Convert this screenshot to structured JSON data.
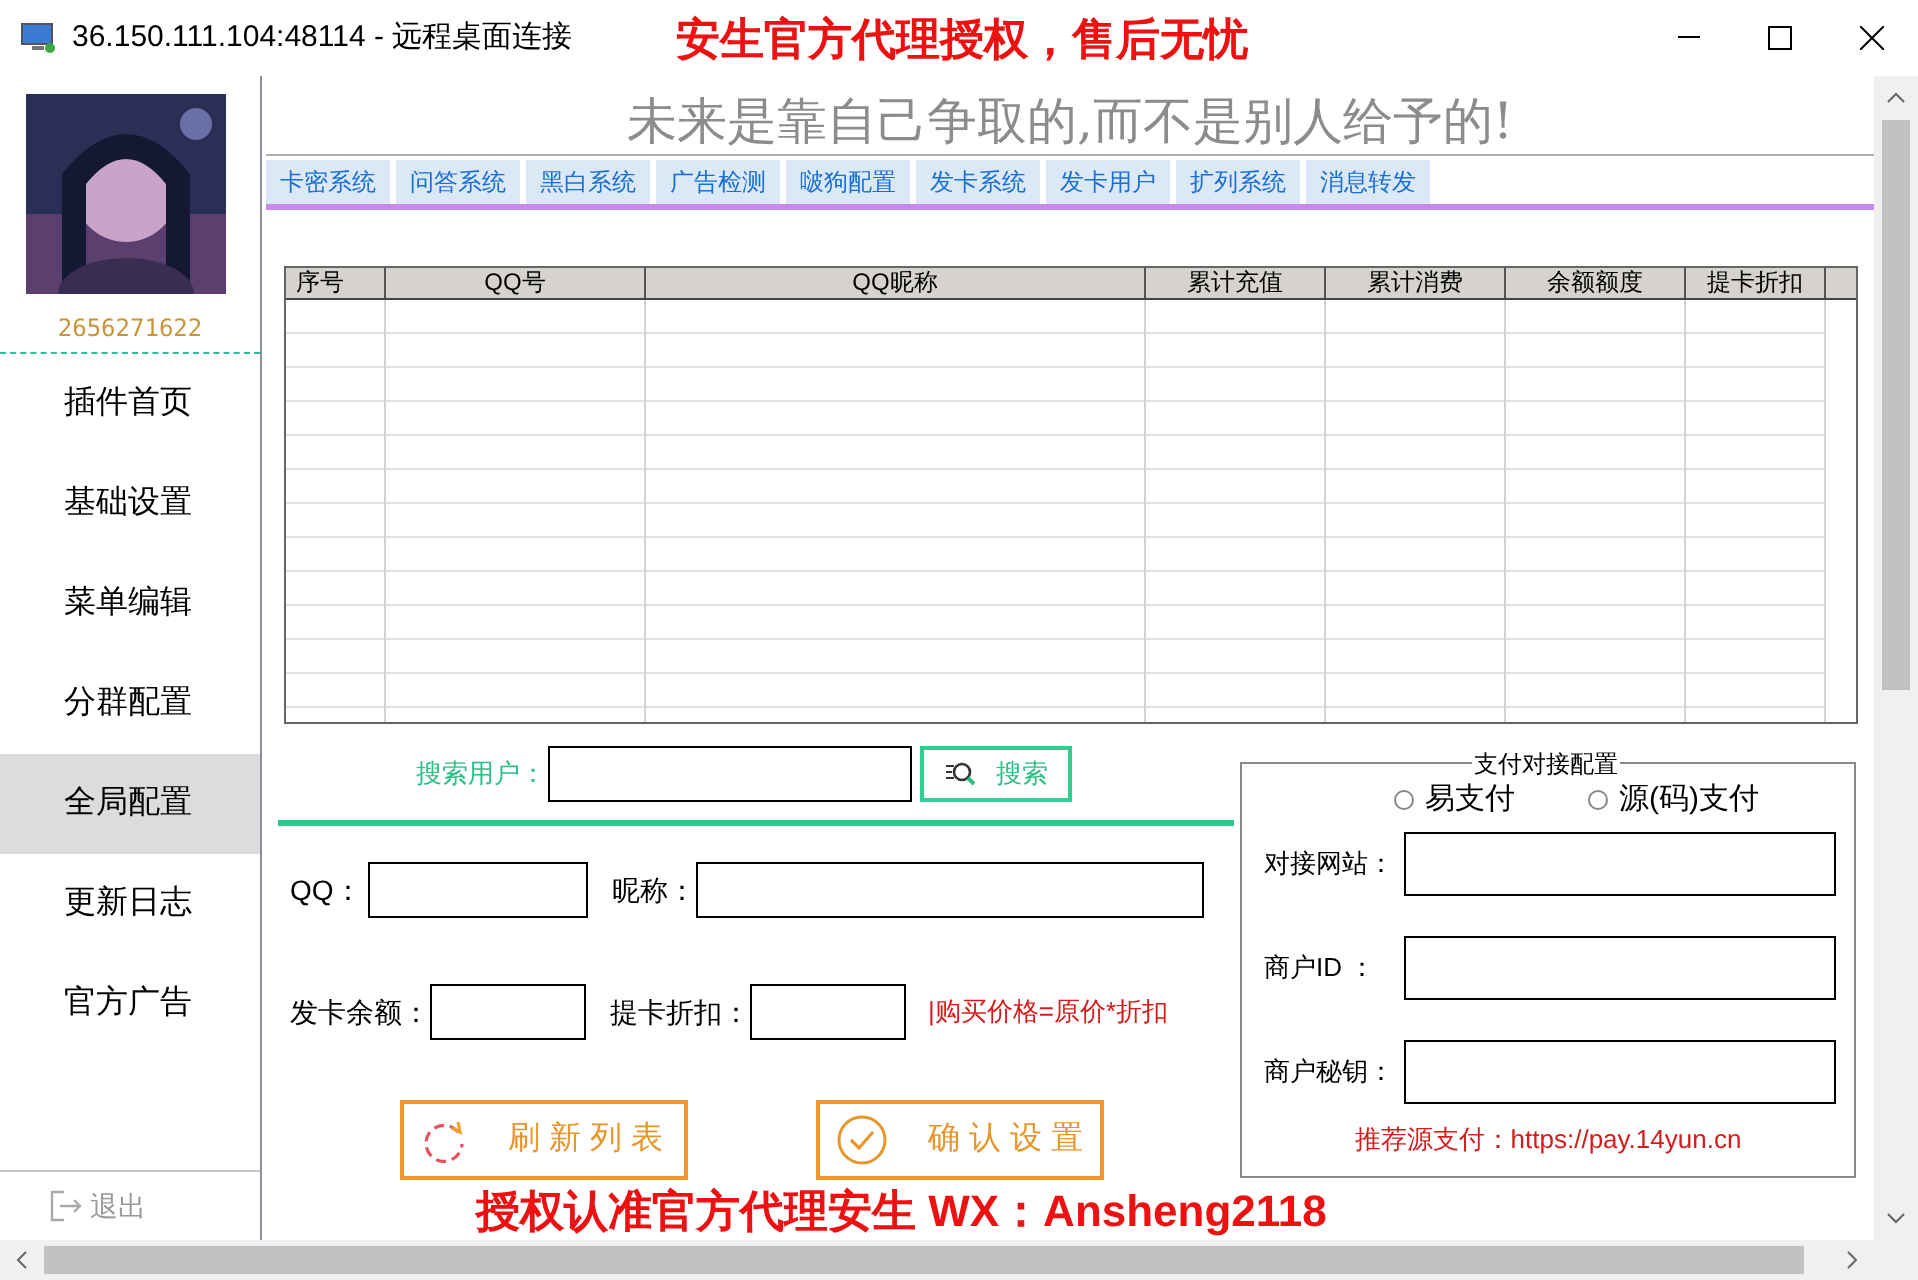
{
  "window": {
    "title": "36.150.111.104:48114 - 远程桌面连接",
    "promo": "安生官方代理授权，售后无忧"
  },
  "sidebar": {
    "account": "2656271622",
    "items": [
      {
        "label": "插件首页",
        "selected": false
      },
      {
        "label": "基础设置",
        "selected": false
      },
      {
        "label": "菜单编辑",
        "selected": false
      },
      {
        "label": "分群配置",
        "selected": false
      },
      {
        "label": "全局配置",
        "selected": true
      },
      {
        "label": "更新日志",
        "selected": false
      },
      {
        "label": "官方广告",
        "selected": false
      }
    ],
    "logout": "退出"
  },
  "slogan": "未来是靠自己争取的,而不是别人给予的!",
  "tabs": [
    "卡密系统",
    "问答系统",
    "黑白系统",
    "广告检测",
    "啵狗配置",
    "发卡系统",
    "发卡用户",
    "扩列系统",
    "消息转发"
  ],
  "table": {
    "columns": [
      "序号",
      "QQ号",
      "QQ昵称",
      "累计充值",
      "累计消费",
      "余额额度",
      "提卡折扣"
    ]
  },
  "search": {
    "label": "搜索用户：",
    "button": "搜索"
  },
  "form": {
    "qq_label": "QQ：",
    "nickname_label": "昵称：",
    "balance_label": "发卡余额：",
    "discount_label": "提卡折扣：",
    "hint": "|购买价格=原价*折扣"
  },
  "buttons": [
    {
      "label": "刷 新 列 表",
      "kind": "refresh"
    },
    {
      "label": "确 认 设 置",
      "kind": "confirm"
    }
  ],
  "payment": {
    "title": "支付对接配置",
    "options": [
      {
        "label": "易支付",
        "selected": false
      },
      {
        "label": "源(码)支付",
        "selected": false
      }
    ],
    "fields": [
      {
        "label": "对接网站："
      },
      {
        "label": "商户ID ："
      },
      {
        "label": "商户秘钥："
      }
    ],
    "note": "推荐源支付：https://pay.14yun.cn"
  },
  "promo": "授权认准官方代理安生  WX：Ansheng2118"
}
